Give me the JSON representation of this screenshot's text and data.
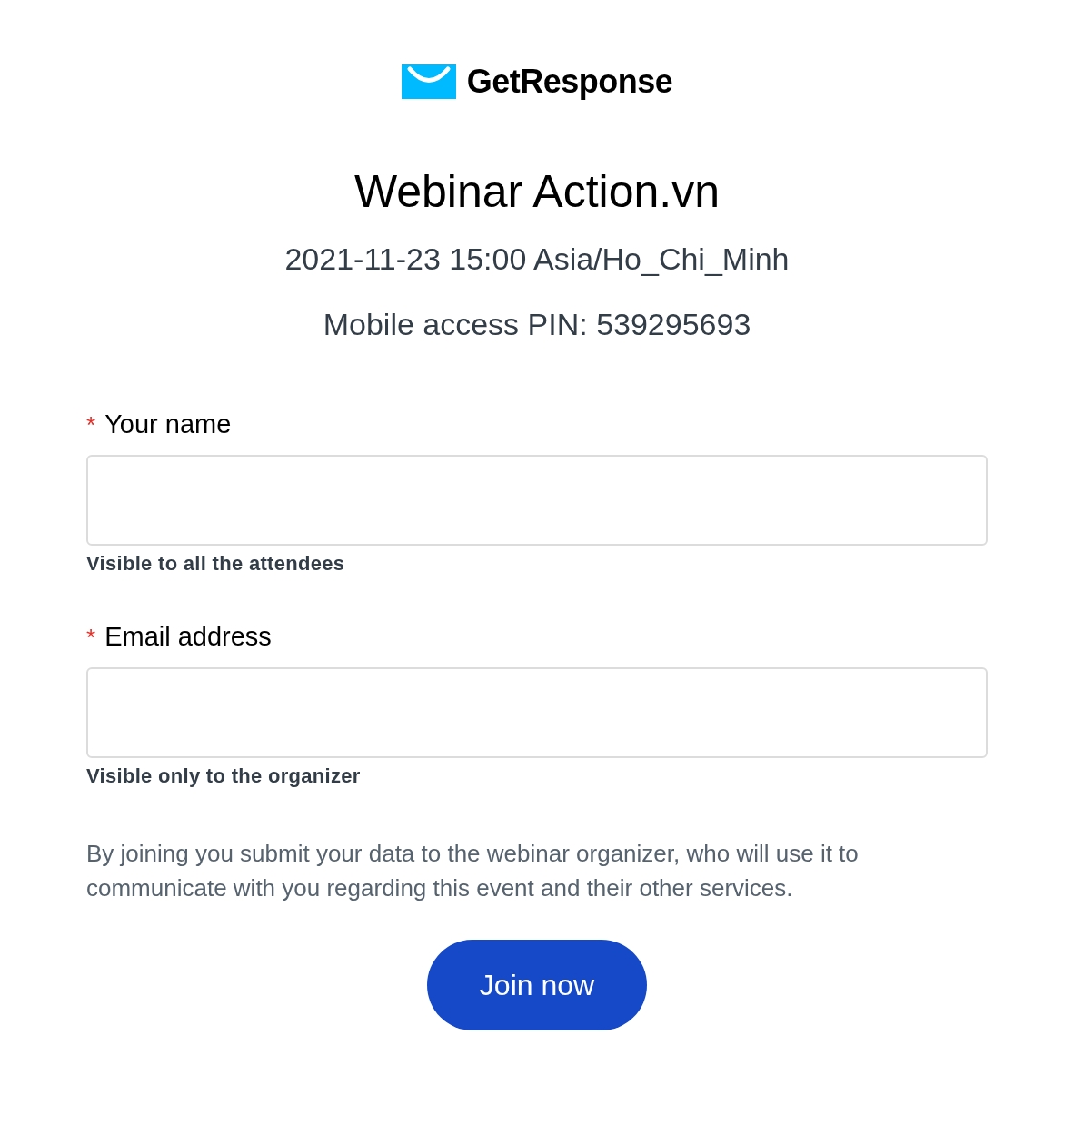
{
  "logo": {
    "text": "GetResponse"
  },
  "title": "Webinar Action.vn",
  "datetime": "2021-11-23 15:00 Asia/Ho_Chi_Minh",
  "pin": "Mobile access PIN: 539295693",
  "fields": [
    {
      "required_mark": "*",
      "label": "Your name",
      "hint": "Visible to all the attendees"
    },
    {
      "required_mark": "*",
      "label": "Email address",
      "hint": "Visible only to the organizer"
    }
  ],
  "consent": "By joining you submit your data to the webinar organizer, who will use it to communicate with you regarding this event and their other services.",
  "button": "Join now"
}
